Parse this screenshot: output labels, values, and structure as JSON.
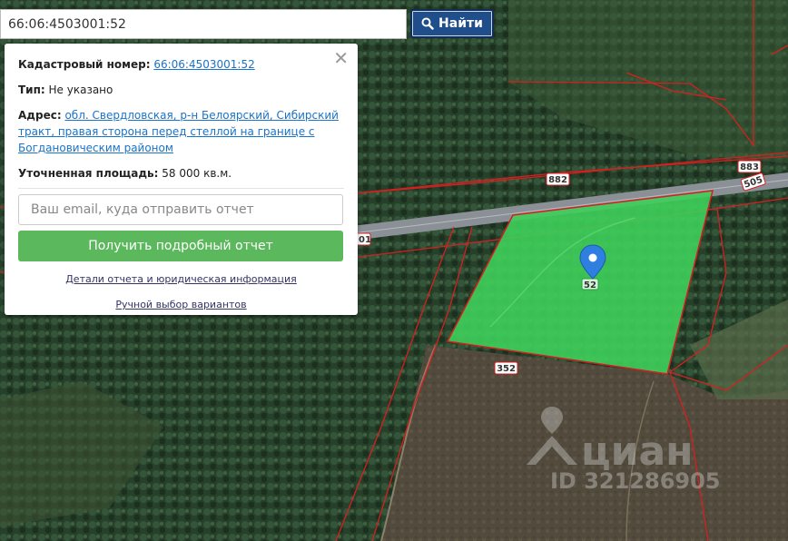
{
  "search": {
    "value": "66:06:4503001:52",
    "button_label": "Найти"
  },
  "popup": {
    "cadastral_label": "Кадастровый номер:",
    "cadastral_value": "66:06:4503001:52",
    "type_label": "Тип:",
    "type_value": "Не указано",
    "address_label": "Адрес:",
    "address_value": "обл. Свердловская, р-н Белоярский, Сибирский тракт, правая сторона перед стеллой на границе с Богдановическим районом",
    "area_label": "Уточненная площадь:",
    "area_value": "58 000 кв.м.",
    "email_placeholder": "Ваш email, куда отправить отчет",
    "get_report_label": "Получить подробный отчет",
    "details_link": "Детали отчета и юридическая информация",
    "manual_link": "Ручной выбор вариантов"
  },
  "map": {
    "parcel_labels": [
      "882",
      "883",
      "505",
      "01",
      "52",
      "352"
    ],
    "highlight_color": "#3ecf5a",
    "boundary_color": "#d42020",
    "pin_color": "#2f7fe0",
    "watermark_brand": "циан",
    "watermark_id": "ID 321286905"
  }
}
